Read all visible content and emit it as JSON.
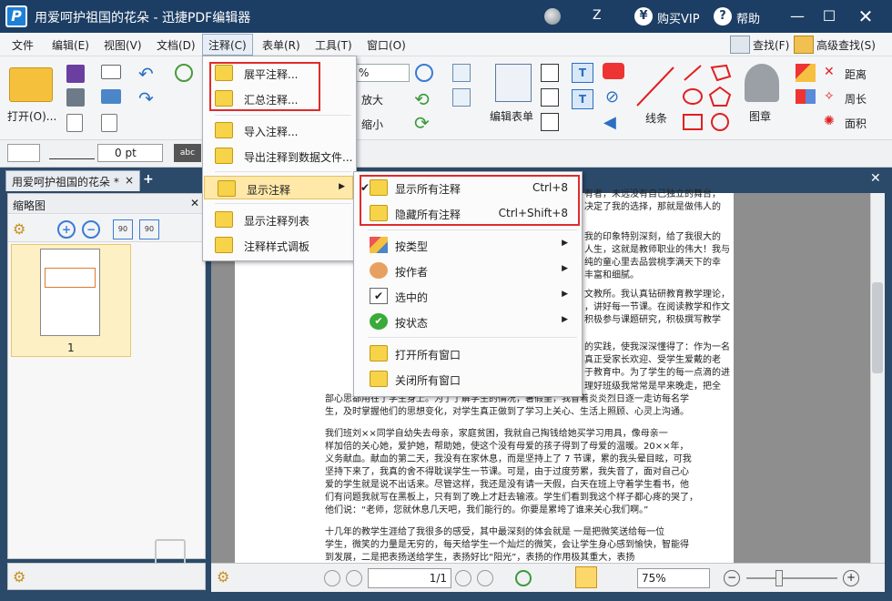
{
  "window": {
    "title": "用爱呵护祖国的花朵 - 迅捷PDF编辑器",
    "user": "Z",
    "vip": "购买VIP",
    "help": "帮助",
    "logo_letter": "P"
  },
  "menubar": [
    "文件",
    "编辑(E)",
    "视图(V)",
    "文档(D)",
    "注释(C)",
    "表单(R)",
    "工具(T)",
    "窗口(O)"
  ],
  "menubar_right": {
    "find": "查找(F)",
    "advanced_find": "高级查找(S)"
  },
  "toolbar": {
    "open": "打开(O)...",
    "zoom_value": "%",
    "zoom_in": "放大",
    "zoom_out": "缩小",
    "edit_form": "编辑表单",
    "line": "线条",
    "stamp": "图章",
    "distance": "距离",
    "perimeter": "周长",
    "area": "面积"
  },
  "propbar": {
    "pt_value": "0 pt",
    "font": "abc"
  },
  "tab": {
    "label": "用爱呵护祖国的花朵 *",
    "close": "×",
    "add": "+"
  },
  "thumbnail": {
    "title": "缩略图",
    "page_num": "1",
    "rot1": "90",
    "rot2": "90"
  },
  "annotation_menu": {
    "items": [
      "展平注释...",
      "汇总注释...",
      "导入注释...",
      "导出注释到数据文件...",
      "显示注释",
      "显示注释列表",
      "注释样式调板"
    ]
  },
  "show_submenu": {
    "items": [
      {
        "label": "显示所有注释",
        "shortcut": "Ctrl+8"
      },
      {
        "label": "隐藏所有注释",
        "shortcut": "Ctrl+Shift+8"
      },
      {
        "label": "按类型"
      },
      {
        "label": "按作者"
      },
      {
        "label": "选中的"
      },
      {
        "label": "按状态"
      },
      {
        "label": "打开所有窗口"
      },
      {
        "label": "关闭所有窗口"
      }
    ]
  },
  "document_lines": [
    "有者，未远没有自己独立的舞台，",
    "决定了我的选择，那就是做伟人的",
    "我的印象特别深刻，给了我很大的",
    "人生，这就是教师职业的伟大！我与",
    "纯的童心里去品尝桃李满天下的幸",
    "丰富和细腻。",
    "文教所。我认真钻研教育教学理论，",
    "，讲好每一节课。在阅读教学和作文",
    "积极参与课题研究，积极撰写教学",
    "的实践，使我深深懂得了：作为一名",
    "真正受家长欢迎、受学生爱戴的老",
    "于教育中。为了学生的每一点滴的进",
    "理好班级我常常是早来晚走，把全",
    "部心思都用在了学生身上。为了了解学生的情况，暑假里，我冒着炎炎烈日逐一走访每名学",
    "生，及时掌握他们的思想变化，对学生真正做到了学习上关心、生活上照顾、心灵上沟通。",
    "    我们班刘××同学自幼失去母亲，家庭贫困，我就自己掏钱给她买学习用具，像母亲一",
    "样加倍的关心她，爱护她，帮助她，使这个没有母爱的孩子得到了母爱的温暖。20××年，",
    "义务献血。献血的第二天，我没有在家休息，而是坚持上了 7 节课，累的我头晕目眩，可我",
    "坚持下来了，我真的舍不得耽误学生一节课。可是，由于过度劳累，我失音了，面对自己心",
    "爱的学生就是说不出话来。尽管这样，我还是没有请一天假，白天在班上守着学生看书，他",
    "们有问题我就写在黑板上，只有到了晚上才赶去输液。学生们看到我这个样子都心疼的哭了，",
    "他们说：“老师，您就休息几天吧，我们能行的。你要是累垮了谁来关心我们啊。”",
    "    十几年的教学生涯给了我很多的感受，其中最深刻的体会就是 一是把微笑送给每一位",
    "学生，微笑的力量是无穷的，每天给学生一个灿烂的微笑，会让学生身心感到愉快，智能得",
    "到发展，二是把表扬送给学生，表扬好比“阳光”，表扬的作用极其重大，表扬"
  ],
  "statusbar": {
    "page": "1/1",
    "zoom": "75%"
  }
}
